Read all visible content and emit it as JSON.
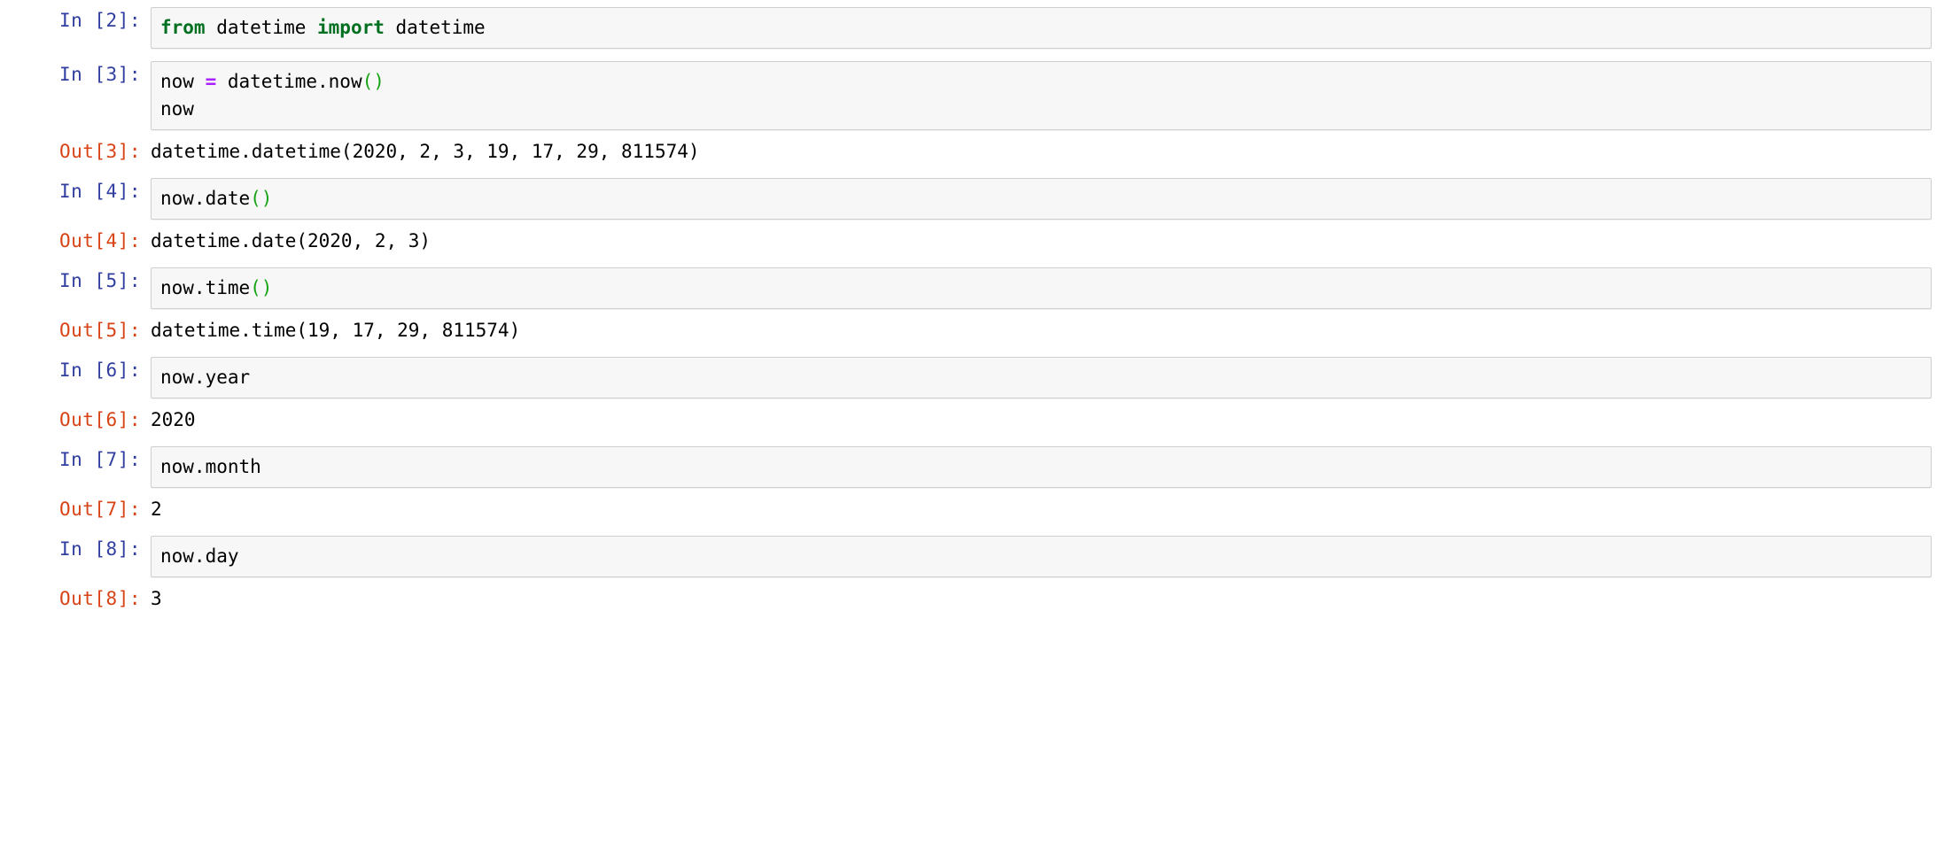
{
  "notebook": {
    "cells": [
      {
        "type": "input",
        "prompt": "In [2]:",
        "lines": [
          [
            {
              "t": "from",
              "c": "kw"
            },
            {
              "t": " datetime ",
              "c": "plain"
            },
            {
              "t": "import",
              "c": "kw"
            },
            {
              "t": " datetime",
              "c": "plain"
            }
          ]
        ]
      },
      {
        "type": "input",
        "prompt": "In [3]:",
        "lines": [
          [
            {
              "t": "now ",
              "c": "plain"
            },
            {
              "t": "=",
              "c": "op"
            },
            {
              "t": " datetime.now",
              "c": "plain"
            },
            {
              "t": "()",
              "c": "paren"
            }
          ],
          [
            {
              "t": "now",
              "c": "plain"
            }
          ]
        ]
      },
      {
        "type": "output",
        "prompt": "Out[3]:",
        "text": "datetime.datetime(2020, 2, 3, 19, 17, 29, 811574)"
      },
      {
        "type": "input",
        "prompt": "In [4]:",
        "lines": [
          [
            {
              "t": "now.date",
              "c": "plain"
            },
            {
              "t": "()",
              "c": "paren"
            }
          ]
        ]
      },
      {
        "type": "output",
        "prompt": "Out[4]:",
        "text": "datetime.date(2020, 2, 3)"
      },
      {
        "type": "input",
        "prompt": "In [5]:",
        "lines": [
          [
            {
              "t": "now.time",
              "c": "plain"
            },
            {
              "t": "()",
              "c": "paren"
            }
          ]
        ]
      },
      {
        "type": "output",
        "prompt": "Out[5]:",
        "text": "datetime.time(19, 17, 29, 811574)"
      },
      {
        "type": "input",
        "prompt": "In [6]:",
        "lines": [
          [
            {
              "t": "now.year",
              "c": "plain"
            }
          ]
        ]
      },
      {
        "type": "output",
        "prompt": "Out[6]:",
        "text": "2020"
      },
      {
        "type": "input",
        "prompt": "In [7]:",
        "lines": [
          [
            {
              "t": "now.month",
              "c": "plain"
            }
          ]
        ]
      },
      {
        "type": "output",
        "prompt": "Out[7]:",
        "text": "2"
      },
      {
        "type": "input",
        "prompt": "In [8]:",
        "lines": [
          [
            {
              "t": "now.day",
              "c": "plain"
            }
          ]
        ]
      },
      {
        "type": "output",
        "prompt": "Out[8]:",
        "text": "3"
      }
    ]
  },
  "colors": {
    "in_prompt": "#303F9F",
    "out_prompt": "#D84315",
    "keyword": "#007020",
    "operator": "#AA22FF",
    "paren": "#14a314",
    "cell_background": "#f7f7f7",
    "cell_border": "#cfcfcf",
    "page_background": "#ffffff",
    "text": "#000000"
  }
}
